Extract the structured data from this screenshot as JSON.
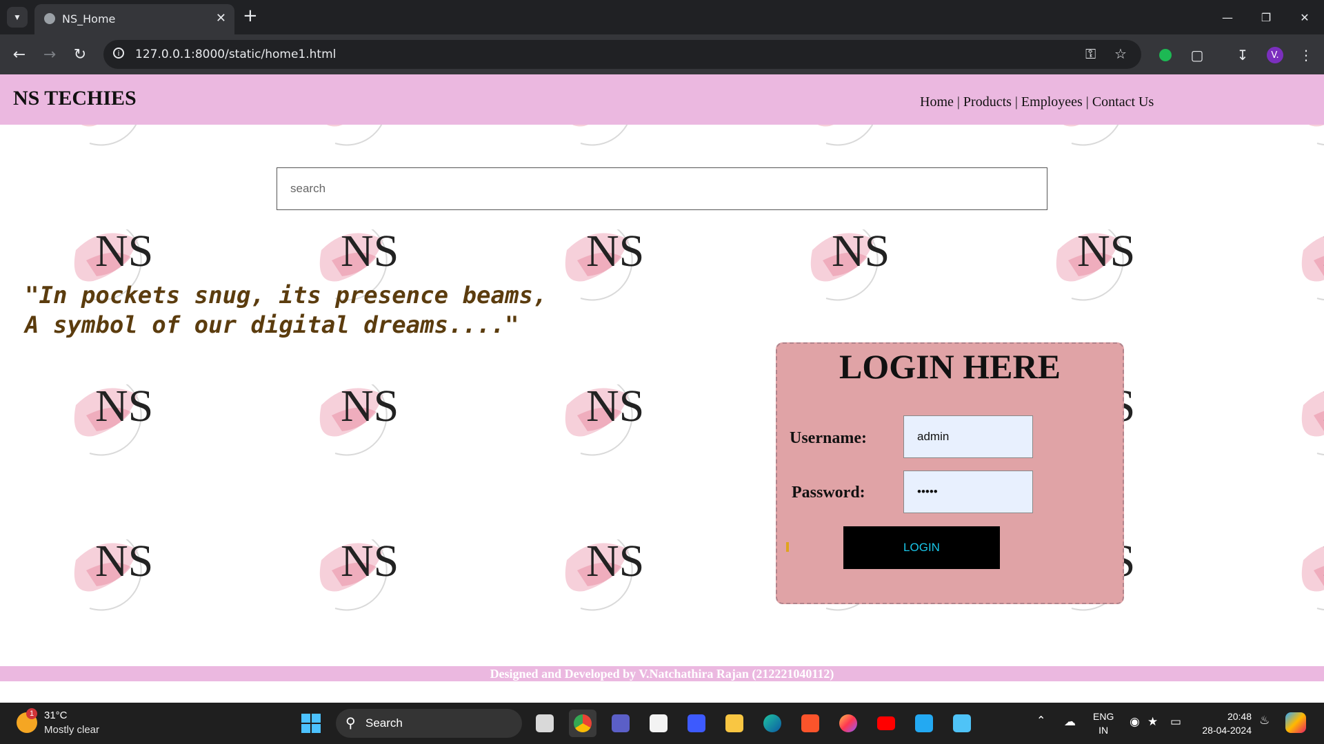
{
  "browser": {
    "tab_title": "NS_Home",
    "url": "127.0.0.1:8000/static/home1.html",
    "profile_initial": "V."
  },
  "site": {
    "brand": "NS TECHIES",
    "background_logo_text": "NS",
    "nav": [
      "Home",
      "Products",
      "Employees",
      "Contact Us"
    ],
    "nav_separator": "|",
    "search_placeholder": "search",
    "quote_line1": "\"In pockets snug, its presence beams,",
    "quote_line2": "A symbol of our digital dreams....\"",
    "login": {
      "title": "LOGIN HERE",
      "username_label": "Username:",
      "username_value": "admin",
      "password_label": "Password:",
      "password_value": "admin",
      "button_label": "LOGIN"
    },
    "footer": "Designed and Developed by V.Natchathira Rajan (212221040112)",
    "colors": {
      "header_bg": "#ebb8e0",
      "login_box_bg": "#e0a3a6",
      "login_button_text": "#19c6e8",
      "quote_text": "#5b3c0e"
    }
  },
  "taskbar": {
    "weather_badge": "1",
    "temperature": "31°C",
    "weather": "Mostly clear",
    "search_label": "Search",
    "lang_line1": "ENG",
    "lang_line2": "IN",
    "time": "20:48",
    "date": "28-04-2024",
    "app_icons": [
      "task-view-icon",
      "chrome-icon",
      "teams-icon",
      "store-icon",
      "vm-icon",
      "file-explorer-icon",
      "edge-icon",
      "brave-icon",
      "firefox-icon",
      "youtube-icon",
      "vscode-icon",
      "notepad-icon"
    ]
  }
}
